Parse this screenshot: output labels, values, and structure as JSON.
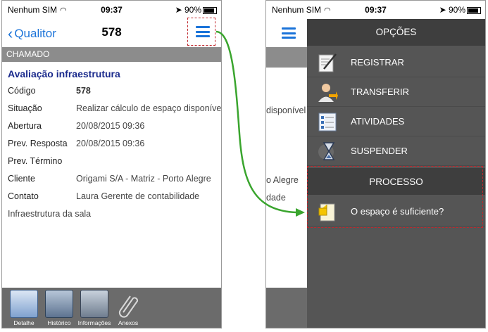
{
  "left_screen": {
    "status": {
      "carrier": "Nenhum SIM",
      "time": "09:37",
      "battery": "90%"
    },
    "nav": {
      "back_label": "Qualitor",
      "title": "578"
    },
    "section_label": "CHAMADO",
    "item_title": "Avaliação infraestrutura",
    "fields": [
      {
        "label": "Código",
        "value": "578"
      },
      {
        "label": "Situação",
        "value": "Realizar cálculo de espaço disponível"
      },
      {
        "label": "Abertura",
        "value": "20/08/2015 09:36"
      },
      {
        "label": "Prev. Resposta",
        "value": "20/08/2015 09:36"
      },
      {
        "label": "Prev. Término",
        "value": ""
      },
      {
        "label": "Cliente",
        "value": "Origami S/A - Matriz - Porto Alegre"
      },
      {
        "label": "Contato",
        "value": "Laura Gerente de contabilidade"
      }
    ],
    "description": "Infraestrutura da sala",
    "tabs": [
      {
        "label": "Detalhe",
        "icon": "detail-icon"
      },
      {
        "label": "Histórico",
        "icon": "history-drawer-icon"
      },
      {
        "label": "Informações",
        "icon": "info-list-icon"
      },
      {
        "label": "Anexos",
        "icon": "paperclip-icon"
      }
    ]
  },
  "right_screen": {
    "status": {
      "carrier": "Nenhum SIM",
      "time": "09:37",
      "battery": "90%"
    },
    "background_fragments": [
      "disponível",
      "o Alegre",
      "dade"
    ],
    "menu": {
      "options_header": "OPÇÕES",
      "options": [
        {
          "label": "REGISTRAR",
          "icon": "pen-paper-icon"
        },
        {
          "label": "TRANSFERIR",
          "icon": "person-transfer-icon"
        },
        {
          "label": "ATIVIDADES",
          "icon": "checklist-icon"
        },
        {
          "label": "SUSPENDER",
          "icon": "hourglass-icon"
        }
      ],
      "process_header": "PROCESSO",
      "process_items": [
        {
          "label": "O espaço é suficiente?",
          "icon": "question-document-icon"
        }
      ]
    }
  },
  "colors": {
    "accent_blue": "#1a73d9",
    "section_gray": "#8c8c8c",
    "menu_bg": "#555555",
    "menu_header_bg": "#3e3e3e",
    "highlight_dashed": "#c0282d",
    "arrow_green": "#3aa52e",
    "title_navy": "#1a2a8c"
  }
}
